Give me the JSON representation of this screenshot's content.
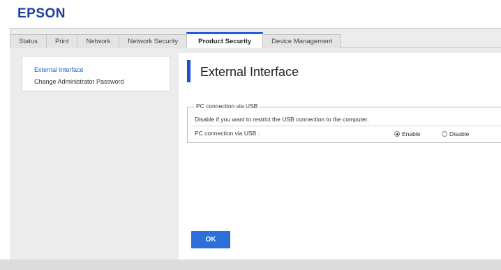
{
  "header": {
    "logo": "EPSON"
  },
  "tabs": [
    {
      "label": "Status"
    },
    {
      "label": "Print"
    },
    {
      "label": "Network"
    },
    {
      "label": "Network Security"
    },
    {
      "label": "Product Security"
    },
    {
      "label": "Device Management"
    }
  ],
  "active_tab": "Product Security",
  "sidebar": {
    "items": [
      {
        "label": "External Interface"
      },
      {
        "label": "Change Administrator Password"
      }
    ]
  },
  "main": {
    "title": "External Interface",
    "group": {
      "legend": "PC connection via USB",
      "description": "Disable if you want to restrict the USB connection to the computer.",
      "row_label": "PC connection via USB :",
      "options": [
        {
          "label": "Enable",
          "selected": true
        },
        {
          "label": "Disable",
          "selected": false
        }
      ]
    },
    "ok_label": "OK"
  },
  "colors": {
    "brand": "#1a3d9b",
    "accent": "#1f5ed6",
    "button": "#2d6fd8"
  }
}
